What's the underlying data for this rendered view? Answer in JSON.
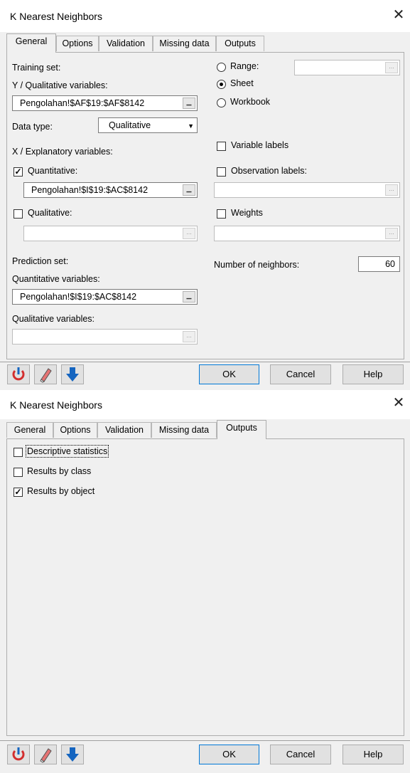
{
  "dialog1": {
    "title": "K Nearest Neighbors",
    "tabs": [
      "General",
      "Options",
      "Validation",
      "Missing data",
      "Outputs"
    ],
    "active_tab": "General",
    "training_set_label": "Training set:",
    "y_label": "Y / Qualitative variables:",
    "y_value": "Pengolahan!$AF$19:$AF$8142",
    "data_type_label": "Data type:",
    "data_type_value": "Qualitative",
    "x_label": "X / Explanatory variables:",
    "quantitative_label": "Quantitative:",
    "quantitative_checked": true,
    "quantitative_value": "Pengolahan!$I$19:$AC$8142",
    "qualitative_label": "Qualitative:",
    "qualitative_checked": false,
    "qualitative_value": "",
    "prediction_set_label": "Prediction set:",
    "pred_quant_label": "Quantitative variables:",
    "pred_quant_value": "Pengolahan!$I$19:$AC$8142",
    "pred_qual_label": "Qualitative variables:",
    "pred_qual_value": "",
    "range_label": "Range:",
    "sheet_label": "Sheet",
    "workbook_label": "Workbook",
    "selected_output": "Sheet",
    "range_value": "",
    "variable_labels_label": "Variable labels",
    "variable_labels_checked": false,
    "observation_labels_label": "Observation labels:",
    "observation_labels_checked": false,
    "observation_labels_value": "",
    "weights_label": "Weights",
    "weights_checked": false,
    "weights_value": "",
    "neighbors_label": "Number of neighbors:",
    "neighbors_value": "60",
    "ellipsis": "...",
    "collapse_glyph": "▁"
  },
  "dialog2": {
    "title": "K Nearest Neighbors",
    "tabs": [
      "General",
      "Options",
      "Validation",
      "Missing data",
      "Outputs"
    ],
    "active_tab": "Outputs",
    "options": [
      {
        "label": "Descriptive statistics",
        "checked": false
      },
      {
        "label": "Results by class",
        "checked": false
      },
      {
        "label": "Results by object",
        "checked": true
      }
    ]
  },
  "buttons": {
    "ok": "OK",
    "cancel": "Cancel",
    "help": "Help"
  },
  "toolbar_icons": [
    "reset-icon",
    "eraser-icon",
    "down-arrow-icon"
  ],
  "colors": {
    "accent_blue": "#1565c0",
    "reset_red": "#d32f2f",
    "default_button_border": "#0078d7"
  }
}
